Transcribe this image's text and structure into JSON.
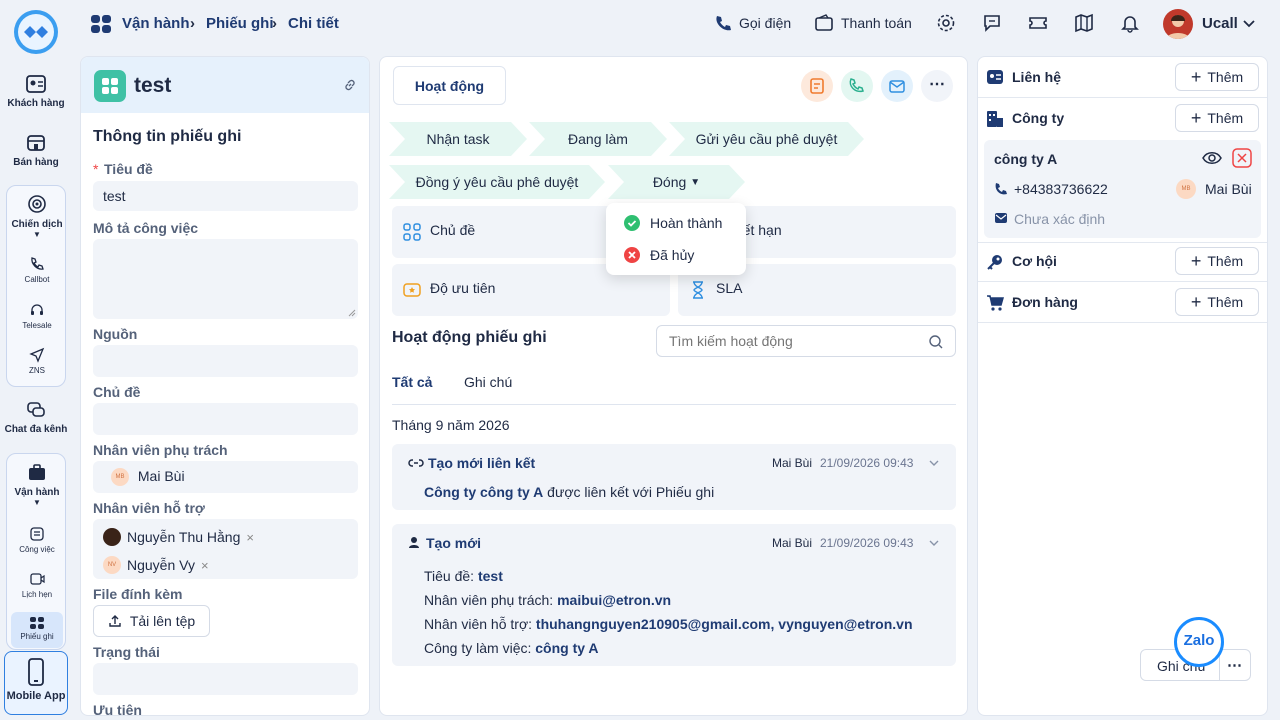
{
  "sidebar": {
    "items": [
      {
        "label": "Khách hàng"
      },
      {
        "label": "Bán hàng"
      },
      {
        "label": "Chiến dịch"
      },
      {
        "label": "Callbot"
      },
      {
        "label": "Telesale"
      },
      {
        "label": "ZNS"
      },
      {
        "label": "Chat đa kênh"
      },
      {
        "label": "Vận hành"
      },
      {
        "label": "Công việc"
      },
      {
        "label": "Lịch hẹn"
      },
      {
        "label": "Phiếu ghi"
      },
      {
        "label": "Mobile App"
      }
    ]
  },
  "header": {
    "breadcrumb": [
      "Vận hành",
      "Phiếu ghi",
      "Chi tiết"
    ],
    "call": "Gọi điện",
    "payment": "Thanh toán",
    "user": "Ucall"
  },
  "left": {
    "title": "test",
    "section": "Thông tin phiếu ghi",
    "required_mark": "*",
    "fields": {
      "title_label": "Tiêu đề",
      "title_value": "test",
      "desc_label": "Mô tả công việc",
      "source_label": "Nguồn",
      "topic_label": "Chủ đề",
      "assignee_label": "Nhân viên phụ trách",
      "assignee_initials": "MB",
      "assignee": "Mai Bùi",
      "support_label": "Nhân viên hỗ trợ",
      "support1": "Nguyễn Thu Hằng",
      "support2_initials": "NV",
      "support2": "Nguyễn Vy",
      "remove": "×",
      "file_label": "File đính kèm",
      "upload": "Tải lên tệp",
      "status_label": "Trạng thái",
      "priority_label": "Ưu tiên"
    }
  },
  "mid": {
    "tab": "Hoạt động",
    "stages": [
      "Nhận task",
      "Đang làm",
      "Gửi yêu cầu phê duyệt",
      "Đồng ý yêu cầu phê duyệt",
      "Đóng"
    ],
    "dropdown": [
      "Hoàn thành",
      "Đã hủy"
    ],
    "cards": [
      "Chủ đề",
      "y hết hạn",
      "Độ ưu tiên",
      "SLA"
    ],
    "activity_title": "Hoạt động phiếu ghi",
    "search_placeholder": "Tìm kiếm hoạt động",
    "tabs": [
      "Tất cả",
      "Ghi chú"
    ],
    "month": "Tháng 9 năm 2026",
    "a1": {
      "title": "Tạo mới liên kết",
      "user": "Mai Bùi",
      "time": "21/09/2026 09:43",
      "link": "Công ty công ty A",
      "text": " được liên kết với Phiếu ghi"
    },
    "a2": {
      "title": "Tạo mới",
      "user": "Mai Bùi",
      "time": "21/09/2026 09:43",
      "l1": "Tiêu đề: ",
      "v1": "test",
      "l2": "Nhân viên phụ trách: ",
      "v2": "maibui@etron.vn",
      "l3": "Nhân viên hỗ trợ: ",
      "v3": "thuhangnguyen210905@gmail.com, vynguyen@etron.vn",
      "l4": "Công ty làm việc: ",
      "v4": "công ty A"
    }
  },
  "right": {
    "add": "Thêm",
    "contact": "Liên hệ",
    "company": "Công ty",
    "company_name": "công ty A",
    "phone": "+84383736622",
    "owner_initials": "MB",
    "owner": "Mai Bùi",
    "email": "Chưa xác định",
    "opportunity": "Cơ hội",
    "order": "Đơn hàng",
    "note": "Ghi chú",
    "more": "⋯",
    "zalo": "Zalo"
  },
  "colors": {
    "accent": "#1f3b73",
    "stage": "#e5f7f2",
    "teal": "#3fc1a5",
    "success": "#2fbf71",
    "danger": "#ef4444"
  }
}
